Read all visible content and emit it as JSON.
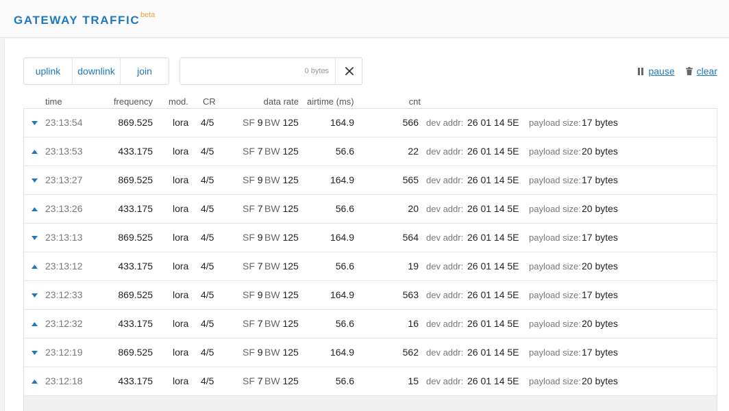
{
  "header": {
    "title": "GATEWAY TRAFFIC",
    "badge": "beta"
  },
  "filters": [
    {
      "label": "uplink"
    },
    {
      "label": "downlink"
    },
    {
      "label": "join"
    }
  ],
  "search": {
    "placeholder": "0 bytes"
  },
  "actions": {
    "pause_label": "pause",
    "clear_label": "clear"
  },
  "columns": {
    "time": "time",
    "frequency": "frequency",
    "mod": "mod.",
    "cr": "CR",
    "data_rate": "data rate",
    "airtime": "airtime (ms)",
    "cnt": "cnt"
  },
  "colors": {
    "accent": "#1d78c1",
    "badge": "#e8a33d"
  },
  "rows": [
    {
      "direction": "down",
      "icon": "arrow-down-icon",
      "time": "23:13:54",
      "frequency": "869.525",
      "mod": "lora",
      "cr": "4/5",
      "sf_label": "SF",
      "sf": "9",
      "bw_label": "BW",
      "bw": "125",
      "airtime": "164.9",
      "cnt": "566",
      "dev_addr_label": "dev addr:",
      "dev_addr": "26 01 14 5E",
      "payload_label": "payload size:",
      "payload": "17 bytes"
    },
    {
      "direction": "up",
      "icon": "arrow-up-icon",
      "time": "23:13:53",
      "frequency": "433.175",
      "mod": "lora",
      "cr": "4/5",
      "sf_label": "SF",
      "sf": "7",
      "bw_label": "BW",
      "bw": "125",
      "airtime": "56.6",
      "cnt": "22",
      "dev_addr_label": "dev addr:",
      "dev_addr": "26 01 14 5E",
      "payload_label": "payload size:",
      "payload": "20 bytes"
    },
    {
      "direction": "down",
      "icon": "arrow-down-icon",
      "time": "23:13:27",
      "frequency": "869.525",
      "mod": "lora",
      "cr": "4/5",
      "sf_label": "SF",
      "sf": "9",
      "bw_label": "BW",
      "bw": "125",
      "airtime": "164.9",
      "cnt": "565",
      "dev_addr_label": "dev addr:",
      "dev_addr": "26 01 14 5E",
      "payload_label": "payload size:",
      "payload": "17 bytes"
    },
    {
      "direction": "up",
      "icon": "arrow-up-icon",
      "time": "23:13:26",
      "frequency": "433.175",
      "mod": "lora",
      "cr": "4/5",
      "sf_label": "SF",
      "sf": "7",
      "bw_label": "BW",
      "bw": "125",
      "airtime": "56.6",
      "cnt": "20",
      "dev_addr_label": "dev addr:",
      "dev_addr": "26 01 14 5E",
      "payload_label": "payload size:",
      "payload": "20 bytes"
    },
    {
      "direction": "down",
      "icon": "arrow-down-icon",
      "time": "23:13:13",
      "frequency": "869.525",
      "mod": "lora",
      "cr": "4/5",
      "sf_label": "SF",
      "sf": "9",
      "bw_label": "BW",
      "bw": "125",
      "airtime": "164.9",
      "cnt": "564",
      "dev_addr_label": "dev addr:",
      "dev_addr": "26 01 14 5E",
      "payload_label": "payload size:",
      "payload": "17 bytes"
    },
    {
      "direction": "up",
      "icon": "arrow-up-icon",
      "time": "23:13:12",
      "frequency": "433.175",
      "mod": "lora",
      "cr": "4/5",
      "sf_label": "SF",
      "sf": "7",
      "bw_label": "BW",
      "bw": "125",
      "airtime": "56.6",
      "cnt": "19",
      "dev_addr_label": "dev addr:",
      "dev_addr": "26 01 14 5E",
      "payload_label": "payload size:",
      "payload": "20 bytes"
    },
    {
      "direction": "down",
      "icon": "arrow-down-icon",
      "time": "23:12:33",
      "frequency": "869.525",
      "mod": "lora",
      "cr": "4/5",
      "sf_label": "SF",
      "sf": "9",
      "bw_label": "BW",
      "bw": "125",
      "airtime": "164.9",
      "cnt": "563",
      "dev_addr_label": "dev addr:",
      "dev_addr": "26 01 14 5E",
      "payload_label": "payload size:",
      "payload": "17 bytes"
    },
    {
      "direction": "up",
      "icon": "arrow-up-icon",
      "time": "23:12:32",
      "frequency": "433.175",
      "mod": "lora",
      "cr": "4/5",
      "sf_label": "SF",
      "sf": "7",
      "bw_label": "BW",
      "bw": "125",
      "airtime": "56.6",
      "cnt": "16",
      "dev_addr_label": "dev addr:",
      "dev_addr": "26 01 14 5E",
      "payload_label": "payload size:",
      "payload": "20 bytes"
    },
    {
      "direction": "down",
      "icon": "arrow-down-icon",
      "time": "23:12:19",
      "frequency": "869.525",
      "mod": "lora",
      "cr": "4/5",
      "sf_label": "SF",
      "sf": "9",
      "bw_label": "BW",
      "bw": "125",
      "airtime": "164.9",
      "cnt": "562",
      "dev_addr_label": "dev addr:",
      "dev_addr": "26 01 14 5E",
      "payload_label": "payload size:",
      "payload": "17 bytes"
    },
    {
      "direction": "up",
      "icon": "arrow-up-icon",
      "time": "23:12:18",
      "frequency": "433.175",
      "mod": "lora",
      "cr": "4/5",
      "sf_label": "SF",
      "sf": "7",
      "bw_label": "BW",
      "bw": "125",
      "airtime": "56.6",
      "cnt": "15",
      "dev_addr_label": "dev addr:",
      "dev_addr": "26 01 14 5E",
      "payload_label": "payload size:",
      "payload": "20 bytes"
    }
  ]
}
